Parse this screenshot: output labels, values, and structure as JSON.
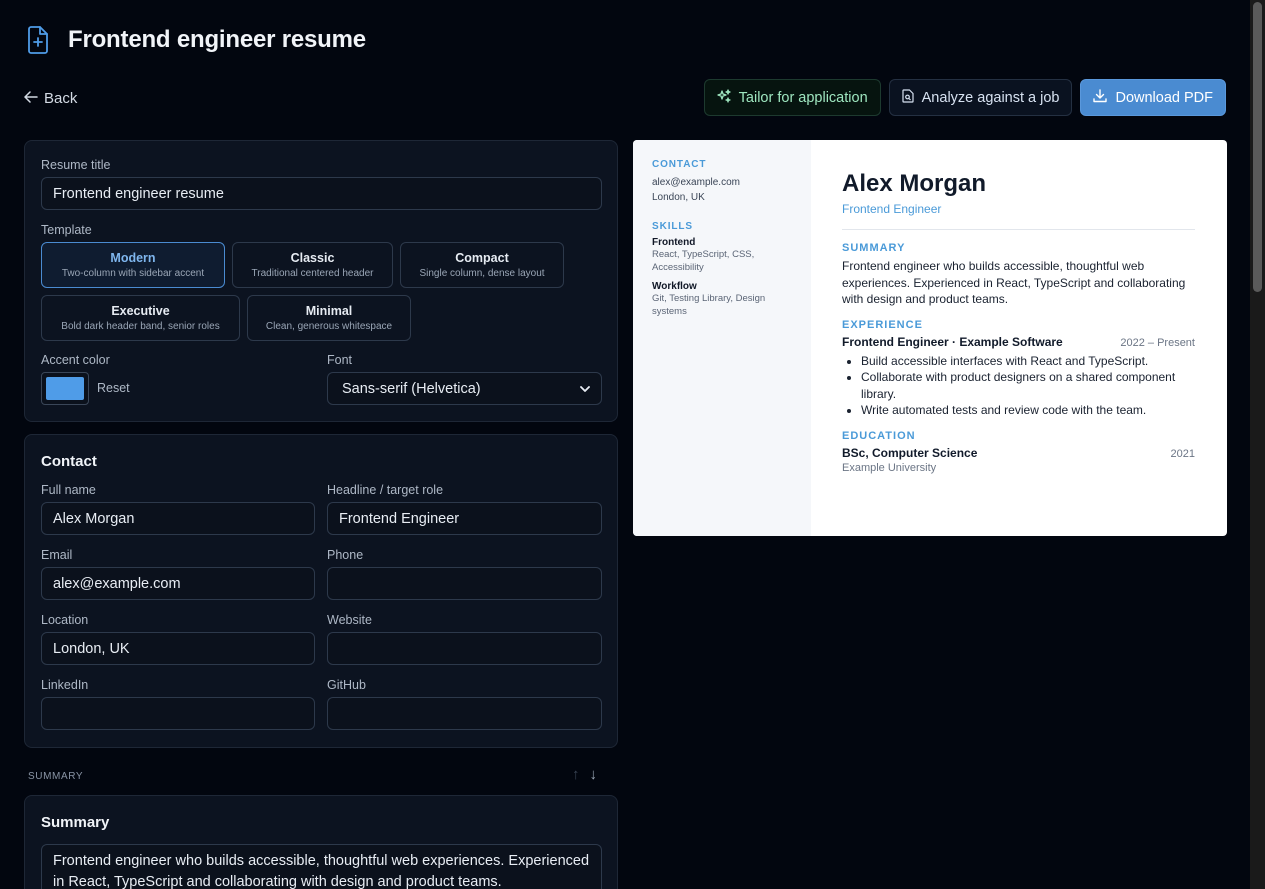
{
  "page": {
    "title": "Frontend engineer resume"
  },
  "nav": {
    "back_label": "Back"
  },
  "actions": {
    "tailor_label": "Tailor for application",
    "analyze_label": "Analyze against a job",
    "download_label": "Download PDF"
  },
  "settings": {
    "title_label": "Resume title",
    "title_value": "Frontend engineer resume",
    "template_label": "Template",
    "templates": [
      {
        "name": "Modern",
        "desc": "Two-column with sidebar accent",
        "selected": true
      },
      {
        "name": "Classic",
        "desc": "Traditional centered header",
        "selected": false
      },
      {
        "name": "Compact",
        "desc": "Single column, dense layout",
        "selected": false
      },
      {
        "name": "Executive",
        "desc": "Bold dark header band, senior roles",
        "selected": false
      },
      {
        "name": "Minimal",
        "desc": "Clean, generous whitespace",
        "selected": false
      }
    ],
    "accent_label": "Accent color",
    "accent_color": "#4f9ce8",
    "reset_label": "Reset",
    "font_label": "Font",
    "font_value": "Sans-serif (Helvetica)"
  },
  "contact": {
    "heading": "Contact",
    "fields": {
      "full_name": {
        "label": "Full name",
        "value": "Alex Morgan"
      },
      "headline": {
        "label": "Headline / target role",
        "value": "Frontend Engineer"
      },
      "email": {
        "label": "Email",
        "value": "alex@example.com"
      },
      "phone": {
        "label": "Phone",
        "value": ""
      },
      "location": {
        "label": "Location",
        "value": "London, UK"
      },
      "website": {
        "label": "Website",
        "value": ""
      },
      "linkedin": {
        "label": "LinkedIn",
        "value": ""
      },
      "github": {
        "label": "GitHub",
        "value": ""
      }
    }
  },
  "summary_section": {
    "caption": "SUMMARY",
    "heading": "Summary",
    "text": "Frontend engineer who builds accessible, thoughtful web experiences. Experienced in React, TypeScript and collaborating with design and product teams."
  },
  "preview": {
    "contact_heading": "CONTACT",
    "email": "alex@example.com",
    "location": "London, UK",
    "skills_heading": "SKILLS",
    "skills": [
      {
        "name": "Frontend",
        "items": "React, TypeScript, CSS, Accessibility"
      },
      {
        "name": "Workflow",
        "items": "Git, Testing Library, Design systems"
      }
    ],
    "name": "Alex Morgan",
    "role": "Frontend Engineer",
    "summary_heading": "SUMMARY",
    "summary": "Frontend engineer who builds accessible, thoughtful web experiences. Experienced in React, TypeScript and collaborating with design and product teams.",
    "experience_heading": "EXPERIENCE",
    "job_title": "Frontend Engineer · Example Software",
    "job_dates": "2022 – Present",
    "bullets": [
      "Build accessible interfaces with React and TypeScript.",
      "Collaborate with product designers on a shared component library.",
      "Write automated tests and review code with the team."
    ],
    "education_heading": "EDUCATION",
    "degree": "BSc, Computer Science",
    "degree_year": "2021",
    "school": "Example University"
  }
}
